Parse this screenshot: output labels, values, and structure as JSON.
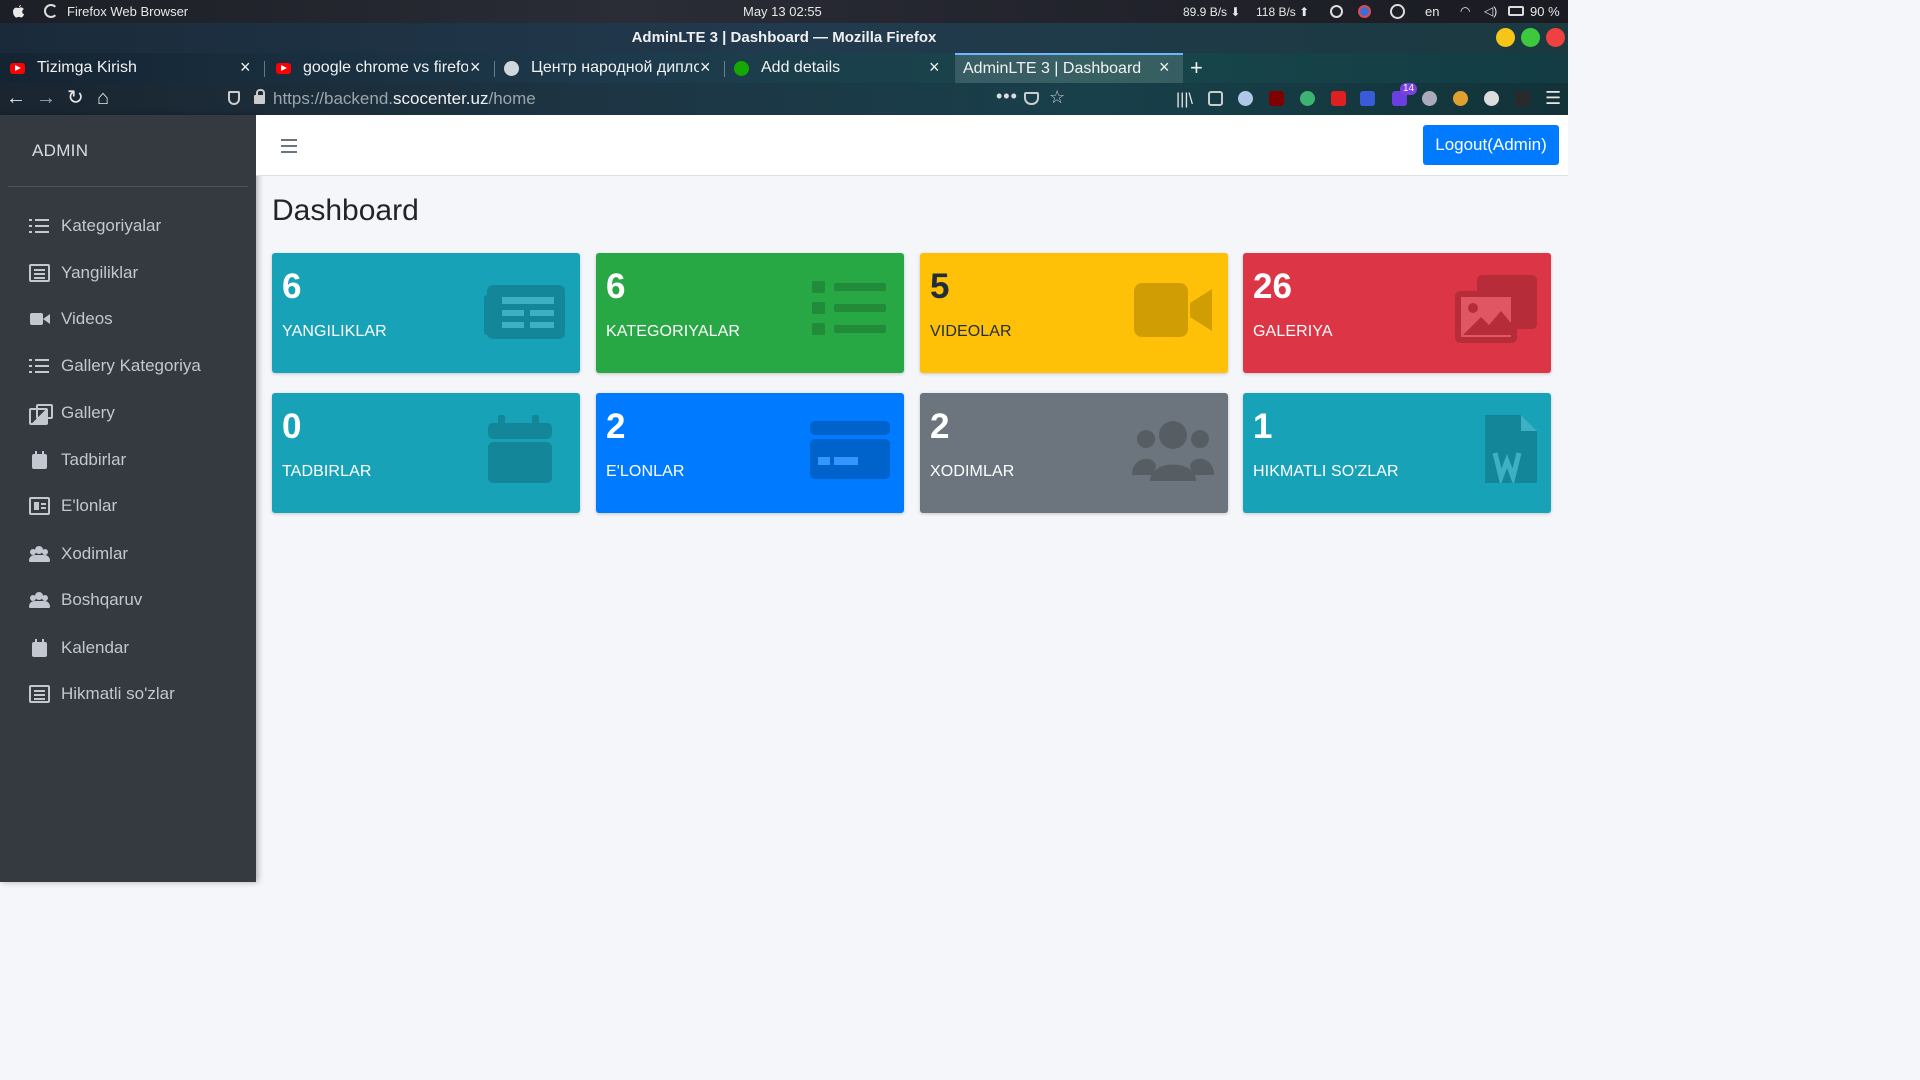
{
  "os": {
    "app_name": "Firefox Web Browser",
    "clock": "May 13  02:55",
    "net_down": "89.9 B/s  ⬇",
    "net_up": "118 B/s  ⬆",
    "lang": "en",
    "battery": "90 %"
  },
  "window": {
    "title": "AdminLTE 3 | Dashboard — Mozilla Firefox"
  },
  "tabs": [
    {
      "label": "Tizimga Kirish"
    },
    {
      "label": "google chrome vs firefox"
    },
    {
      "label": "Центр народной дипломатии"
    },
    {
      "label": "Add details"
    },
    {
      "label": "AdminLTE 3 | Dashboard"
    }
  ],
  "url": {
    "prefix": "https://backend.",
    "host": "scocenter.uz",
    "path": "/home"
  },
  "ext_badge": "14",
  "sidebar": {
    "brand": "ADMIN",
    "items": [
      {
        "label": "Kategoriyalar"
      },
      {
        "label": "Yangiliklar"
      },
      {
        "label": "Videos"
      },
      {
        "label": "Gallery Kategoriya"
      },
      {
        "label": "Gallery"
      },
      {
        "label": "Tadbirlar"
      },
      {
        "label": "E'lonlar"
      },
      {
        "label": "Xodimlar"
      },
      {
        "label": "Boshqaruv"
      },
      {
        "label": "Kalendar"
      },
      {
        "label": "Hikmatli so'zlar"
      }
    ]
  },
  "header": {
    "logout_label": "Logout(Admin)"
  },
  "page": {
    "title": "Dashboard"
  },
  "stats": [
    {
      "count": "6",
      "label": "YANGILIKLAR",
      "color": "#17a2b8"
    },
    {
      "count": "6",
      "label": "KATEGORIYALAR",
      "color": "#28a745"
    },
    {
      "count": "5",
      "label": "VIDEOLAR",
      "color": "#ffc107"
    },
    {
      "count": "26",
      "label": "GALERIYA",
      "color": "#dc3545"
    },
    {
      "count": "0",
      "label": "TADBIRLAR",
      "color": "#17a2b8"
    },
    {
      "count": "2",
      "label": "E'LONLAR",
      "color": "#007bff"
    },
    {
      "count": "2",
      "label": "XODIMLAR",
      "color": "#6c757d"
    },
    {
      "count": "1",
      "label": "HIKMATLI SO'ZLAR",
      "color": "#17a2b8"
    }
  ]
}
